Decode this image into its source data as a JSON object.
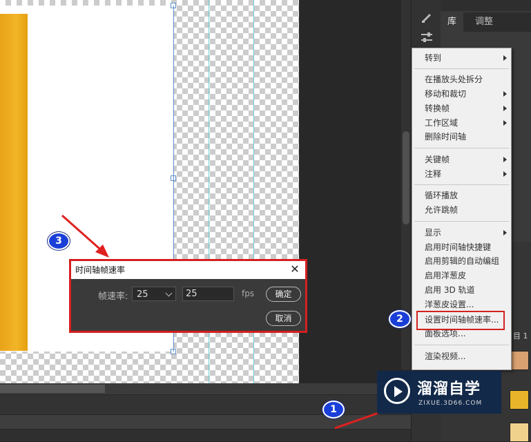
{
  "panel": {
    "tabs": [
      "库",
      "调整"
    ],
    "side_label": "目 1"
  },
  "menu": {
    "items": [
      {
        "label": "转到",
        "sub": true
      },
      {
        "label": "在播放头处拆分",
        "sub": false
      },
      {
        "label": "移动和裁切",
        "sub": true
      },
      {
        "label": "转换帧",
        "sub": true
      },
      {
        "label": "工作区域",
        "sub": true
      },
      {
        "label": "删除时间轴",
        "sub": false
      },
      {
        "label": "关键帧",
        "sub": true
      },
      {
        "label": "注释",
        "sub": true
      },
      {
        "label": "循环播放",
        "sub": false
      },
      {
        "label": "允许跳帧",
        "sub": false
      },
      {
        "label": "显示",
        "sub": true
      },
      {
        "label": "启用时间轴快捷键",
        "sub": false
      },
      {
        "label": "启用剪辑的自动编组",
        "sub": false
      },
      {
        "label": "启用洋葱皮",
        "sub": false
      },
      {
        "label": "启用 3D 轨道",
        "sub": false
      },
      {
        "label": "洋葱皮设置...",
        "sub": false
      },
      {
        "label": "设置时间轴帧速率...",
        "sub": false
      },
      {
        "label": "面板选项...",
        "sub": false
      },
      {
        "label": "渲染视频...",
        "sub": false
      }
    ]
  },
  "dialog": {
    "title": "时间轴帧速率",
    "rate_label": "帧速率:",
    "select_value": "25",
    "input_value": "25",
    "unit": "fps",
    "ok": "确定",
    "cancel": "取消"
  },
  "steps": [
    "1",
    "2",
    "3"
  ],
  "watermark": {
    "title": "溜溜自学",
    "subtitle": "ZIXUE.3D66.COM"
  },
  "colors": {
    "highlight": "#d4201f",
    "badge": "#1a3fd8",
    "layer": "#f1b527"
  }
}
